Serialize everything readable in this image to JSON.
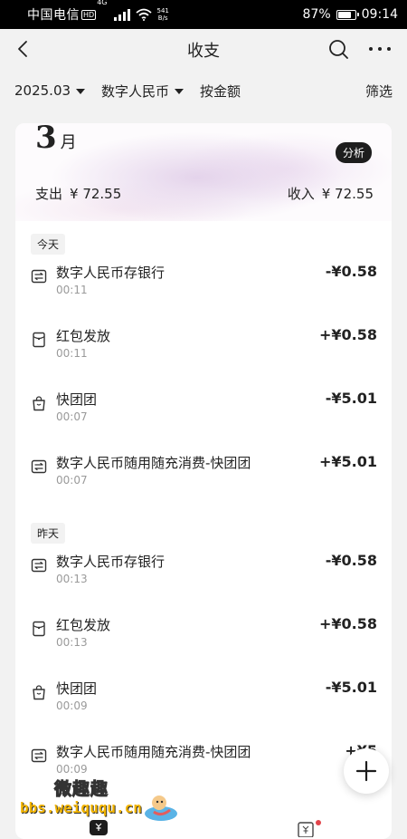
{
  "status": {
    "carrier": "中国电信",
    "hd": "HD",
    "network": "4G",
    "speed_value": "541",
    "speed_unit": "B/s",
    "battery_text": "87%",
    "battery_level": 0.87,
    "time": "09:14"
  },
  "nav": {
    "title": "收支",
    "back_icon": "chevron-left-icon",
    "search_icon": "search-icon",
    "more_icon": "more-dots-icon"
  },
  "filters": {
    "month": "2025.03",
    "currency": "数字人民币",
    "mode": "按金额",
    "screen": "筛选"
  },
  "summary": {
    "month_num": "3",
    "month_unit": "月",
    "analyze": "分析",
    "expense_label": "支出",
    "expense_value": "¥ 72.55",
    "income_label": "收入",
    "income_value": "¥ 72.55"
  },
  "sections": [
    {
      "label": "今天",
      "rows": [
        {
          "icon": "transfer-icon",
          "name": "数字人民币存银行",
          "time": "00:11",
          "amount": "-¥0.58"
        },
        {
          "icon": "red-packet-icon",
          "name": "红包发放",
          "time": "00:11",
          "amount": "+¥0.58"
        },
        {
          "icon": "shopping-bag-icon",
          "name": "快团团",
          "time": "00:07",
          "amount": "-¥5.01"
        },
        {
          "icon": "transfer-icon",
          "name": "数字人民币随用随充消费-快团团",
          "time": "00:07",
          "amount": "+¥5.01"
        }
      ]
    },
    {
      "label": "昨天",
      "rows": [
        {
          "icon": "transfer-icon",
          "name": "数字人民币存银行",
          "time": "00:13",
          "amount": "-¥0.58"
        },
        {
          "icon": "red-packet-icon",
          "name": "红包发放",
          "time": "00:13",
          "amount": "+¥0.58"
        },
        {
          "icon": "shopping-bag-icon",
          "name": "快团团",
          "time": "00:09",
          "amount": "-¥5.01"
        },
        {
          "icon": "transfer-icon",
          "name": "数字人民币随用随充消费-快团团",
          "time": "00:09",
          "amount": "+¥5"
        }
      ]
    }
  ],
  "fab": {
    "icon": "plus-icon"
  },
  "watermark": {
    "title": "微趣趣",
    "url": "bbs.weiququ.cn"
  },
  "colors": {
    "page_bg": "#f2f2f2",
    "card_bg": "#ffffff",
    "text": "#222222",
    "muted": "#9a9a9a",
    "pill_bg": "#1d1d1d"
  }
}
